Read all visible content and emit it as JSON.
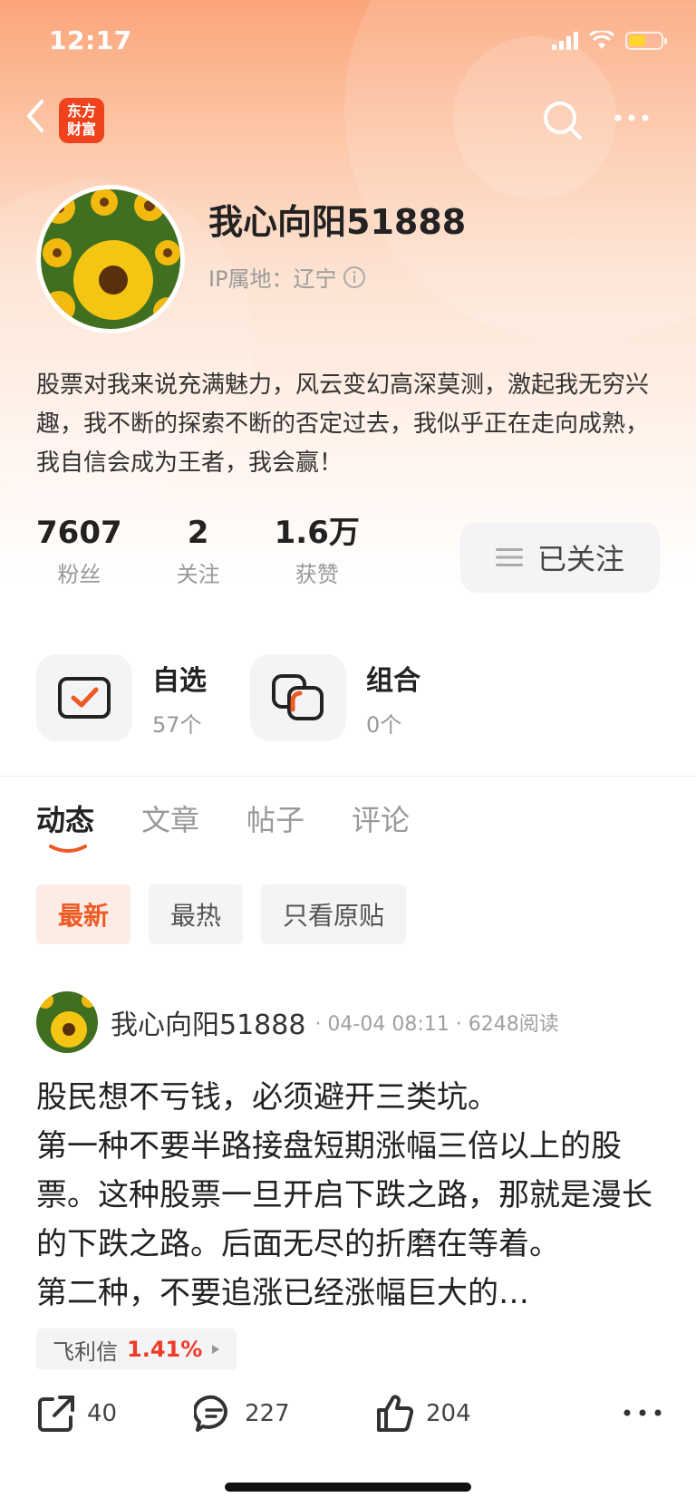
{
  "status_bar": {
    "time": "12:17"
  },
  "nav": {
    "app_logo_line1": "东方",
    "app_logo_line2": "财富"
  },
  "profile": {
    "username": "我心向阳51888",
    "ip_location": "IP属地：辽宁",
    "bio": "股票对我来说充满魅力，风云变幻高深莫测，激起我无穷兴趣，我不断的探索不断的否定过去，我似乎正在走向成熟，我自信会成为王者，我会赢！"
  },
  "stats": [
    {
      "value": "7607",
      "label": "粉丝"
    },
    {
      "value": "2",
      "label": "关注"
    },
    {
      "value": "1.6万",
      "label": "获赞"
    }
  ],
  "follow_button": {
    "label": "已关注"
  },
  "shortcuts": [
    {
      "title": "自选",
      "count": "57个"
    },
    {
      "title": "组合",
      "count": "0个"
    }
  ],
  "tabs": [
    "动态",
    "文章",
    "帖子",
    "评论"
  ],
  "filters": [
    "最新",
    "最热",
    "只看原贴"
  ],
  "post": {
    "author": "我心向阳51888",
    "meta": "· 04-04 08:11 · 6248阅读",
    "body": "股民想不亏钱，必须避开三类坑。\n第一种不要半路接盘短期涨幅三倍以上的股票。这种股票一旦开启下跌之路，那就是漫长的下跌之路。后面无尽的折磨在等着。\n第二种，不要追涨已经涨幅巨大的…",
    "stock_tag": {
      "name": "飞利信",
      "change": "1.41%"
    },
    "actions": {
      "share": "40",
      "comment": "227",
      "like": "204"
    }
  },
  "colors": {
    "accent": "#ee5a24",
    "brand": "#f0431d",
    "up": "#ee3b28"
  }
}
